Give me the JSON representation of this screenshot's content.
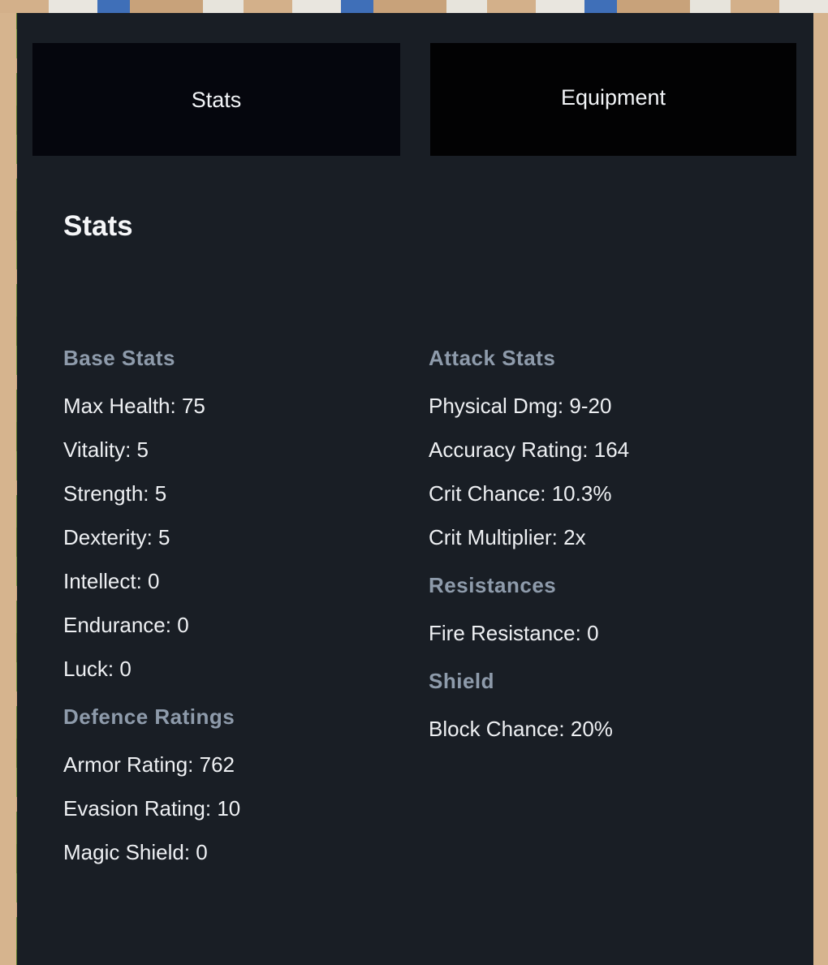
{
  "tabs": [
    {
      "label": "Stats",
      "active": true
    },
    {
      "label": "Equipment",
      "active": false
    }
  ],
  "title": "Stats",
  "left_column": [
    {
      "heading": "Base Stats",
      "items": [
        "Max Health: 75",
        "Vitality: 5",
        "Strength: 5",
        "Dexterity: 5",
        "Intellect: 0",
        "Endurance: 0",
        "Luck: 0"
      ]
    },
    {
      "heading": "Defence Ratings",
      "items": [
        "Armor Rating: 762",
        "Evasion Rating: 10",
        "Magic Shield: 0"
      ]
    }
  ],
  "right_column": [
    {
      "heading": "Attack Stats",
      "items": [
        "Physical Dmg: 9-20",
        "Accuracy Rating: 164",
        "Crit Chance: 10.3%",
        "Crit Multiplier: 2x"
      ]
    },
    {
      "heading": "Resistances",
      "items": [
        "Fire Resistance: 0"
      ]
    },
    {
      "heading": "Shield",
      "items": [
        "Block Chance: 20%"
      ]
    }
  ],
  "colors": {
    "panel": "#191e25",
    "tab_active": "#05060d",
    "tab_inactive": "#020203",
    "heading": "#8e9bab",
    "text": "#eef0f3"
  }
}
